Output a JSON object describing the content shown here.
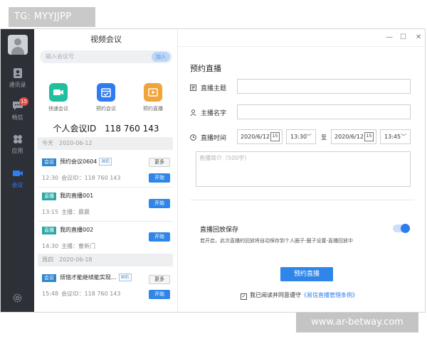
{
  "watermarks": {
    "top": "TG: MYYJJPP",
    "bottom": "www.ar-betway.com"
  },
  "rail": {
    "items": [
      {
        "label": "通讯录",
        "icon": "contacts-icon"
      },
      {
        "label": "畅信",
        "icon": "chat-icon",
        "badge": "15"
      },
      {
        "label": "应用",
        "icon": "apps-icon"
      },
      {
        "label": "会议",
        "icon": "video-camera-icon",
        "active": true
      }
    ],
    "settings_icon": "gear-icon"
  },
  "sidebar": {
    "title": "视频会议",
    "search_placeholder": "输入会议号",
    "join_label": "加入",
    "quick_actions": [
      {
        "label": "快速会议",
        "icon": "video-camera-icon",
        "color": "#1fbf9f"
      },
      {
        "label": "预约会议",
        "icon": "calendar-icon",
        "color": "#2f7cf0"
      },
      {
        "label": "预约直播",
        "icon": "live-play-icon",
        "color": "#f0a43a"
      }
    ],
    "meeting_id_label": "个人会议ID",
    "meeting_id_value": "118 760 143",
    "groups": [
      {
        "day": "今天",
        "date": "2020-06-12",
        "items": [
          {
            "tag": "会议",
            "title": "预约会议0604",
            "mark": "国航",
            "time": "12:30",
            "detail": "会议ID：118 760 143",
            "more": "更多",
            "start": "开始"
          },
          {
            "tag": "直播",
            "title": "我的直播001",
            "time": "13:15",
            "detail": "主播：晨晨",
            "start": "开始"
          },
          {
            "tag": "直播",
            "title": "我的直播002",
            "time": "14:30",
            "detail": "主播：曹新门",
            "start": "开始"
          }
        ]
      },
      {
        "day": "周四",
        "date": "2020-06-18",
        "items": [
          {
            "tag": "会议",
            "title": "烦恼才能继续能实现...",
            "mark": "国航",
            "time": "15:48",
            "detail": "会议ID：118 760 143",
            "more": "更多",
            "start": "开始"
          }
        ]
      }
    ]
  },
  "form": {
    "title": "预约直播",
    "topic_label": "直播主题",
    "host_label": "主播名字",
    "time_label": "直播时间",
    "start_date": "2020/6/12",
    "start_time": "13:30",
    "to_label": "至",
    "end_date": "2020/6/12",
    "end_time": "13:45",
    "calendar_day": "15",
    "intro_placeholder": "直播简介（500字）",
    "replay_label": "直播回放保存",
    "replay_desc": "若开启，此次直播的回放将自动保存到个人圈子-圈子设置-直播回放中",
    "replay_enabled": true,
    "submit_label": "预约直播",
    "agree_text": "我已阅读并同意遵守",
    "agree_link": "《易信直播管理条例》"
  },
  "window_controls": {
    "minimize": "—",
    "maximize": "☐",
    "close": "✕"
  }
}
